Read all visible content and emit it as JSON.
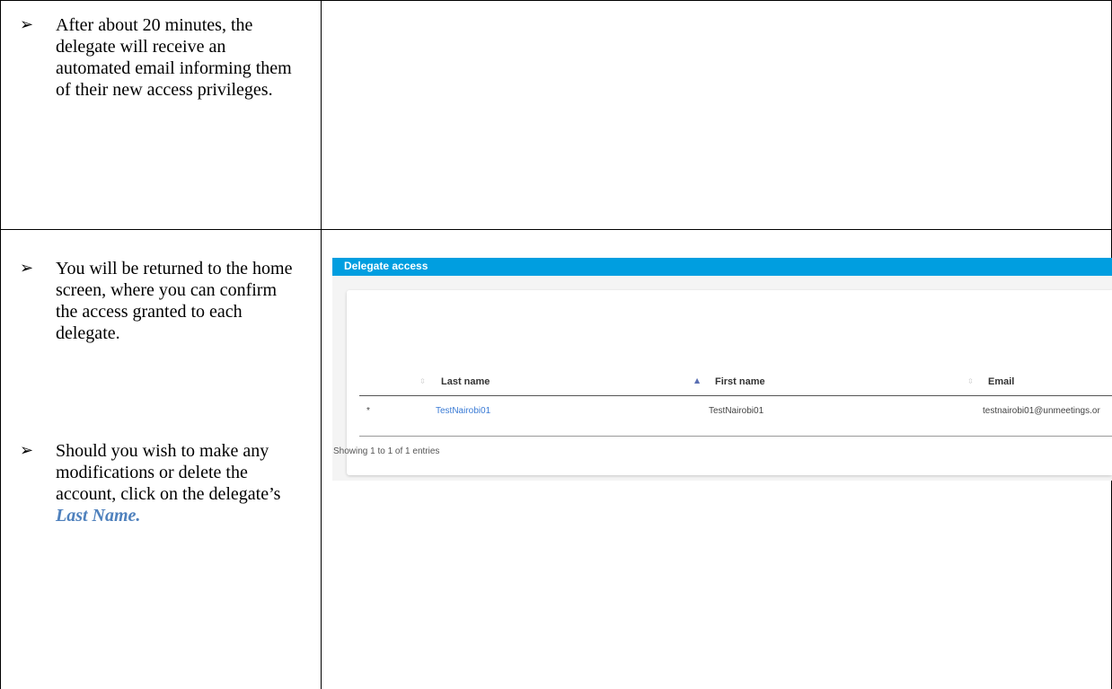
{
  "rows": [
    {
      "bullets": [
        {
          "text": "After about 20 minutes, the delegate will receive an automated email informing them of their new access privileges."
        }
      ]
    },
    {
      "bullets": [
        {
          "text": "You will be returned to the home screen, where you can confirm the access granted to each delegate."
        },
        {
          "text_before": "Should you wish to make any modifications or delete the account, click on the delegate’s ",
          "emphasis": "Last Name."
        }
      ]
    }
  ],
  "bullet_glyph": "➢",
  "panel": {
    "header_title": "Delegate access",
    "columns": [
      "Last name",
      "First name",
      "Email"
    ],
    "rows": [
      {
        "marker": "*",
        "last_name": "TestNairobi01",
        "first_name": "TestNairobi01",
        "email": "testnairobi01@unmeetings.or"
      }
    ],
    "footer": "Showing 1 to 1 of 1 entries",
    "sort_icons": {
      "inactive": "⇳",
      "active": "▲"
    }
  },
  "colors": {
    "header_bg": "#009ee0",
    "link": "#3a7bd5",
    "emphasis": "#4f81bd"
  }
}
